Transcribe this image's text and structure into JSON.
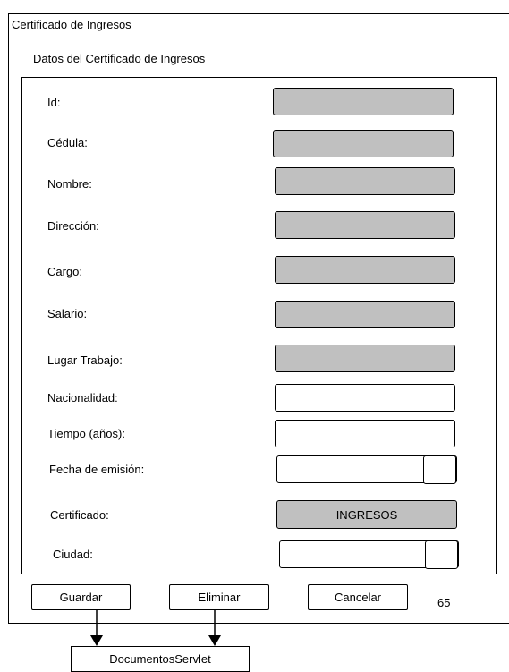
{
  "window": {
    "title": "Certificado de Ingresos"
  },
  "section": {
    "title": "Datos del Certificado de Ingresos"
  },
  "form": {
    "fields": [
      {
        "label": "Id:"
      },
      {
        "label": "Cédula:"
      },
      {
        "label": "Nombre:"
      },
      {
        "label": "Dirección:"
      },
      {
        "label": "Cargo:"
      },
      {
        "label": "Salario:"
      },
      {
        "label": "Lugar Trabajo:"
      },
      {
        "label": "Nacionalidad:"
      },
      {
        "label": "Tiempo (años):"
      },
      {
        "label": "Fecha de emisión:"
      },
      {
        "label": "Certificado:",
        "value": "INGRESOS"
      },
      {
        "label": "Ciudad:"
      }
    ]
  },
  "actions": {
    "save_label": "Guardar",
    "delete_label": "Eliminar",
    "cancel_label": "Cancelar",
    "number": "65"
  },
  "servlet": {
    "label": "DocumentosServlet"
  },
  "colors": {
    "disabled_field": "#c0c0c0",
    "border": "#000000"
  }
}
